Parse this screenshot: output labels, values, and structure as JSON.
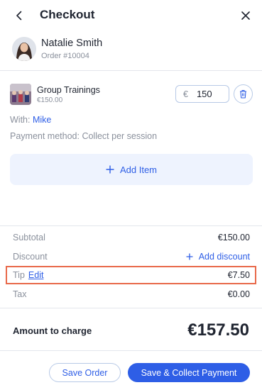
{
  "header": {
    "title": "Checkout",
    "back_icon": "chevron-left-icon",
    "close_icon": "close-icon"
  },
  "customer": {
    "name": "Natalie Smith",
    "order_number": "Order #10004"
  },
  "service": {
    "name": "Group Trainings",
    "price_label": "€150.00",
    "currency_symbol": "€",
    "price_value": "150",
    "staff_prefix": "With:",
    "staff_name": "Mike",
    "payment_method": "Payment method: Collect per session",
    "add_item_label": "Add Item"
  },
  "summary": {
    "subtotal_label": "Subtotal",
    "subtotal_value": "€150.00",
    "discount_label": "Discount",
    "add_discount_label": "Add discount",
    "tip_label": "Tip",
    "tip_edit_label": "Edit",
    "tip_value": "€7.50",
    "tax_label": "Tax",
    "tax_value": "€0.00",
    "amount_label": "Amount to charge",
    "amount_value": "€157.50"
  },
  "footer": {
    "save_order_label": "Save Order",
    "collect_label": "Save & Collect Payment"
  },
  "colors": {
    "accent": "#2e5ee6",
    "highlight": "#e8694a",
    "muted_text": "#8a909c"
  }
}
